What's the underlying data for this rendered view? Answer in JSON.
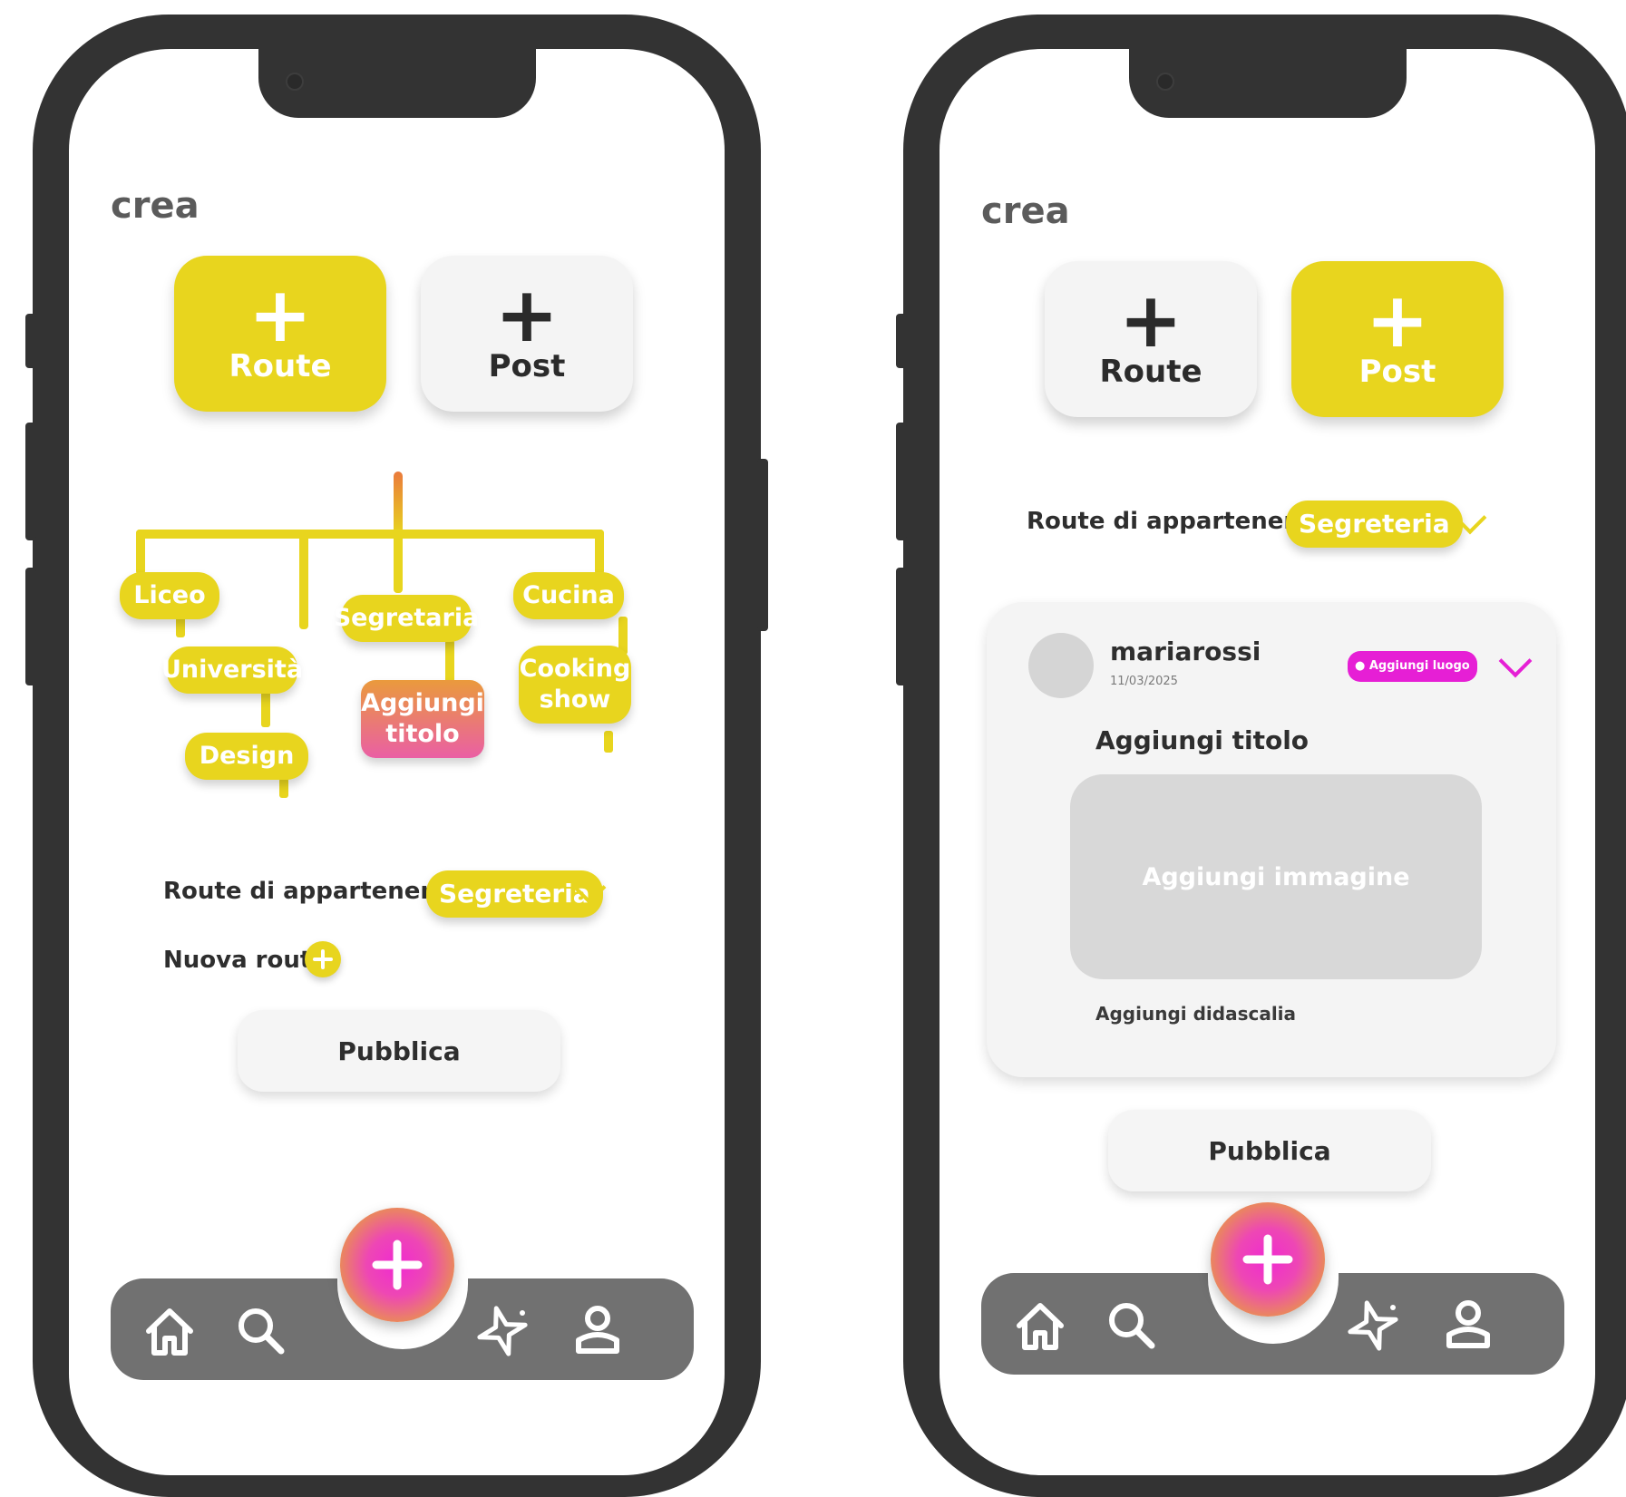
{
  "colors": {
    "accent_yellow": "#e8d51e",
    "accent_pink": "#e61fd5",
    "frame": "#333333",
    "navbar": "#717171"
  },
  "screen1": {
    "title": "crea",
    "tabs": [
      {
        "plus": "+",
        "label": "Route",
        "active": true
      },
      {
        "plus": "+",
        "label": "Post",
        "active": false
      }
    ],
    "tree": {
      "nodes": [
        "Liceo",
        "Università",
        "Design",
        "Segretaria",
        "Aggiungi titolo",
        "Cucina",
        "Cooking show"
      ]
    },
    "route_label": "Route di appartenenza",
    "route_value": "Segreteria",
    "new_route_label": "Nuova route",
    "new_route_icon": "plus-circle-icon",
    "publish": "Pubblica",
    "nav": {
      "fab": "+",
      "icons": [
        "home-icon",
        "search-icon",
        "sparkle-icon",
        "profile-icon"
      ]
    }
  },
  "screen2": {
    "title": "crea",
    "tabs": [
      {
        "plus": "+",
        "label": "Route",
        "active": false
      },
      {
        "plus": "+",
        "label": "Post",
        "active": true
      }
    ],
    "route_label": "Route di appartenenza",
    "route_value": "Segreteria",
    "post": {
      "username": "mariarossi",
      "date": "11/03/2025",
      "location_button": "Aggiungi luogo",
      "title": "Aggiungi titolo",
      "image_placeholder": "Aggiungi immagine",
      "caption": "Aggiungi didascalia"
    },
    "publish": "Pubblica",
    "nav": {
      "fab": "+",
      "icons": [
        "home-icon",
        "search-icon",
        "sparkle-icon",
        "profile-icon"
      ]
    }
  }
}
